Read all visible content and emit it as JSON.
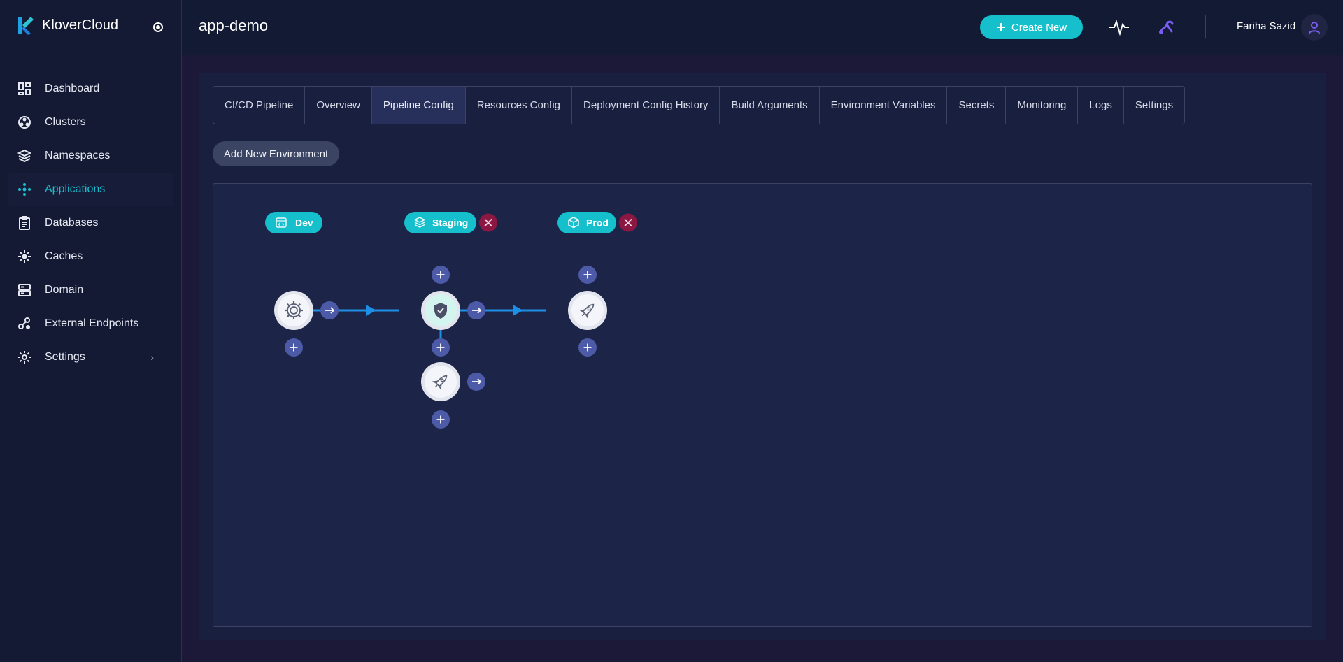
{
  "brand": {
    "name": "KloverCloud"
  },
  "sidebar": {
    "items": [
      {
        "label": "Dashboard",
        "icon": "dashboard-icon"
      },
      {
        "label": "Clusters",
        "icon": "clusters-icon"
      },
      {
        "label": "Namespaces",
        "icon": "layers-icon"
      },
      {
        "label": "Applications",
        "icon": "applications-icon",
        "active": true
      },
      {
        "label": "Databases",
        "icon": "clipboard-icon"
      },
      {
        "label": "Caches",
        "icon": "cache-icon"
      },
      {
        "label": "Domain",
        "icon": "server-icon"
      },
      {
        "label": "External Endpoints",
        "icon": "endpoints-icon"
      },
      {
        "label": "Settings",
        "icon": "gear-icon"
      }
    ]
  },
  "header": {
    "title": "app-demo",
    "create_label": "Create New",
    "user_name": "Fariha Sazid"
  },
  "tabs": [
    "CI/CD Pipeline",
    "Overview",
    "Pipeline Config",
    "Resources Config",
    "Deployment Config History",
    "Build Arguments",
    "Environment Variables",
    "Secrets",
    "Monitoring",
    "Logs",
    "Settings"
  ],
  "active_tab": "Pipeline Config",
  "add_env_label": "Add New Environment",
  "pipeline": {
    "environments": [
      {
        "label": "Dev",
        "icon": "code-icon",
        "removable": false
      },
      {
        "label": "Staging",
        "icon": "layers-icon",
        "removable": true
      },
      {
        "label": "Prod",
        "icon": "box-icon",
        "removable": true
      }
    ],
    "steps": [
      {
        "name": "build-step",
        "icon": "gear-icon"
      },
      {
        "name": "security-step",
        "icon": "shield-check-icon",
        "highlighted": true
      },
      {
        "name": "staging-deploy-step",
        "icon": "rocket-icon"
      },
      {
        "name": "prod-deploy-step",
        "icon": "rocket-icon"
      }
    ]
  },
  "colors": {
    "accent": "#16bfcc",
    "edge": "#1e8fe6",
    "node_button": "#4c5aa8",
    "remove": "#8a1843",
    "sidebar_active": "#19bfcf"
  }
}
